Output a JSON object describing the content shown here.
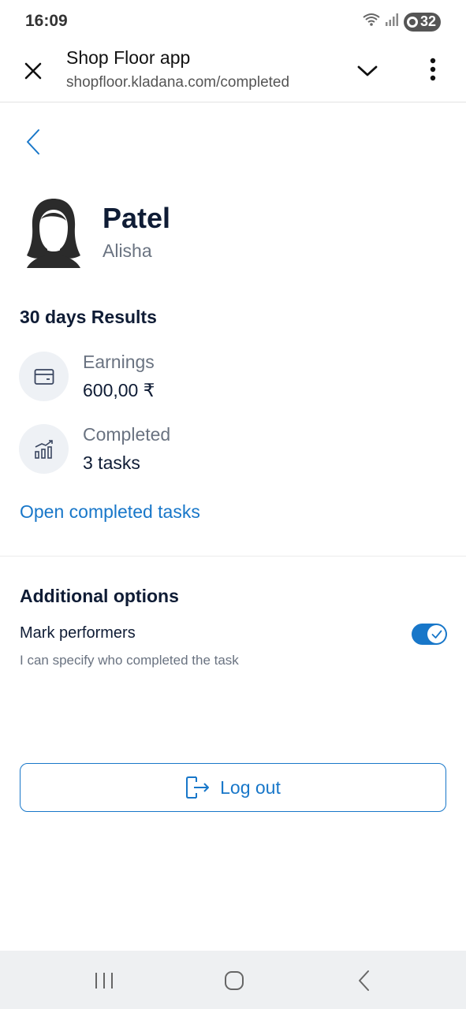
{
  "status_bar": {
    "time": "16:09",
    "battery": "32",
    "icons": [
      "wifi-icon",
      "signal-icon",
      "battery-icon"
    ]
  },
  "browser": {
    "title": "Shop Floor app",
    "url": "shopfloor.kladana.com/completed",
    "icons": [
      "close-icon",
      "chevron-down-icon",
      "more-vert-icon"
    ]
  },
  "profile": {
    "last_name": "Patel",
    "first_name": "Alisha"
  },
  "results": {
    "heading": "30 days Results",
    "earnings": {
      "label": "Earnings",
      "value": "600,00 ₹",
      "icon": "wallet-icon"
    },
    "completed": {
      "label": "Completed",
      "value": "3 tasks",
      "icon": "growth-chart-icon"
    },
    "link": "Open completed tasks"
  },
  "options": {
    "heading": "Additional options",
    "mark_performers": {
      "label": "Mark performers",
      "description": "I can specify who completed the task",
      "enabled": true
    }
  },
  "logout": {
    "label": "Log out",
    "icon": "logout-icon"
  },
  "colors": {
    "accent": "#1877c9",
    "text_primary": "#0f1c35",
    "text_secondary": "#6a7381",
    "icon_bg": "#eef1f5"
  }
}
